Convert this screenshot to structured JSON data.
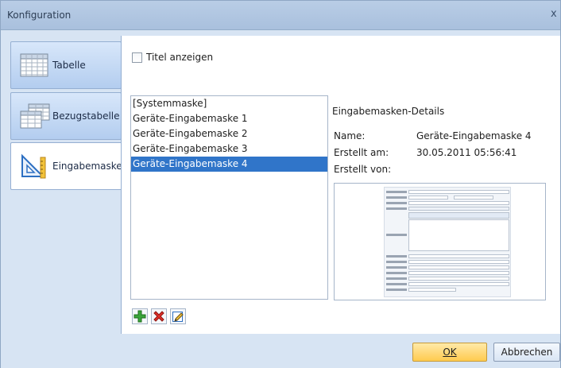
{
  "window": {
    "title": "Konfiguration",
    "close_glyph": "x"
  },
  "sidebar": {
    "items": [
      {
        "label": "Tabelle",
        "icon": "table-icon",
        "active": false
      },
      {
        "label": "Bezugstabelle",
        "icon": "reference-table-icon",
        "active": false
      },
      {
        "label": "Eingabemaske",
        "icon": "input-mask-icon",
        "active": true
      }
    ]
  },
  "main": {
    "show_title_label": "Titel anzeigen",
    "show_title_checked": false,
    "masks": [
      "[Systemmaske]",
      "Geräte-Eingabemaske 1",
      "Geräte-Eingabemaske 2",
      "Geräte-Eingabemaske 3",
      "Geräte-Eingabemaske 4"
    ],
    "selected_index": 4,
    "toolbar": {
      "add_icon": "plus-icon",
      "delete_icon": "delete-x-icon",
      "edit_icon": "edit-icon"
    }
  },
  "details": {
    "title": "Eingabemasken-Details",
    "name_label": "Name:",
    "name_value": "Geräte-Eingabemaske 4",
    "created_label": "Erstellt am:",
    "created_value": "30.05.2011 05:56:41",
    "author_label": "Erstellt von:",
    "author_value": ""
  },
  "footer": {
    "ok_label": "OK",
    "cancel_label": "Abbrechen"
  },
  "colors": {
    "selection": "#3075c9",
    "ok_button": "#ffcb4f",
    "window_bg": "#d7e4f3"
  }
}
